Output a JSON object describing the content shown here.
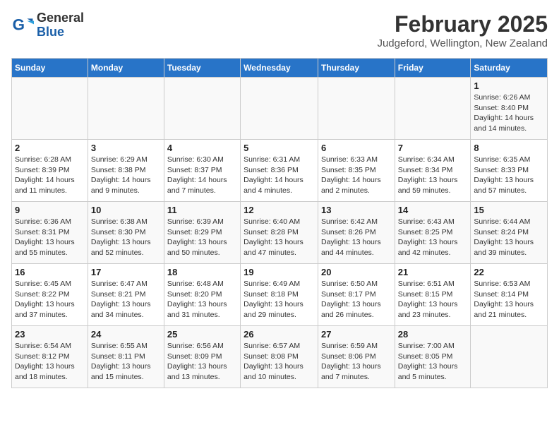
{
  "header": {
    "logo": {
      "general": "General",
      "blue": "Blue"
    },
    "title": "February 2025",
    "subtitle": "Judgeford, Wellington, New Zealand"
  },
  "days_of_week": [
    "Sunday",
    "Monday",
    "Tuesday",
    "Wednesday",
    "Thursday",
    "Friday",
    "Saturday"
  ],
  "weeks": [
    [
      {
        "day": "",
        "info": ""
      },
      {
        "day": "",
        "info": ""
      },
      {
        "day": "",
        "info": ""
      },
      {
        "day": "",
        "info": ""
      },
      {
        "day": "",
        "info": ""
      },
      {
        "day": "",
        "info": ""
      },
      {
        "day": "1",
        "info": "Sunrise: 6:26 AM\nSunset: 8:40 PM\nDaylight: 14 hours\nand 14 minutes."
      }
    ],
    [
      {
        "day": "2",
        "info": "Sunrise: 6:28 AM\nSunset: 8:39 PM\nDaylight: 14 hours\nand 11 minutes."
      },
      {
        "day": "3",
        "info": "Sunrise: 6:29 AM\nSunset: 8:38 PM\nDaylight: 14 hours\nand 9 minutes."
      },
      {
        "day": "4",
        "info": "Sunrise: 6:30 AM\nSunset: 8:37 PM\nDaylight: 14 hours\nand 7 minutes."
      },
      {
        "day": "5",
        "info": "Sunrise: 6:31 AM\nSunset: 8:36 PM\nDaylight: 14 hours\nand 4 minutes."
      },
      {
        "day": "6",
        "info": "Sunrise: 6:33 AM\nSunset: 8:35 PM\nDaylight: 14 hours\nand 2 minutes."
      },
      {
        "day": "7",
        "info": "Sunrise: 6:34 AM\nSunset: 8:34 PM\nDaylight: 13 hours\nand 59 minutes."
      },
      {
        "day": "8",
        "info": "Sunrise: 6:35 AM\nSunset: 8:33 PM\nDaylight: 13 hours\nand 57 minutes."
      }
    ],
    [
      {
        "day": "9",
        "info": "Sunrise: 6:36 AM\nSunset: 8:31 PM\nDaylight: 13 hours\nand 55 minutes."
      },
      {
        "day": "10",
        "info": "Sunrise: 6:38 AM\nSunset: 8:30 PM\nDaylight: 13 hours\nand 52 minutes."
      },
      {
        "day": "11",
        "info": "Sunrise: 6:39 AM\nSunset: 8:29 PM\nDaylight: 13 hours\nand 50 minutes."
      },
      {
        "day": "12",
        "info": "Sunrise: 6:40 AM\nSunset: 8:28 PM\nDaylight: 13 hours\nand 47 minutes."
      },
      {
        "day": "13",
        "info": "Sunrise: 6:42 AM\nSunset: 8:26 PM\nDaylight: 13 hours\nand 44 minutes."
      },
      {
        "day": "14",
        "info": "Sunrise: 6:43 AM\nSunset: 8:25 PM\nDaylight: 13 hours\nand 42 minutes."
      },
      {
        "day": "15",
        "info": "Sunrise: 6:44 AM\nSunset: 8:24 PM\nDaylight: 13 hours\nand 39 minutes."
      }
    ],
    [
      {
        "day": "16",
        "info": "Sunrise: 6:45 AM\nSunset: 8:22 PM\nDaylight: 13 hours\nand 37 minutes."
      },
      {
        "day": "17",
        "info": "Sunrise: 6:47 AM\nSunset: 8:21 PM\nDaylight: 13 hours\nand 34 minutes."
      },
      {
        "day": "18",
        "info": "Sunrise: 6:48 AM\nSunset: 8:20 PM\nDaylight: 13 hours\nand 31 minutes."
      },
      {
        "day": "19",
        "info": "Sunrise: 6:49 AM\nSunset: 8:18 PM\nDaylight: 13 hours\nand 29 minutes."
      },
      {
        "day": "20",
        "info": "Sunrise: 6:50 AM\nSunset: 8:17 PM\nDaylight: 13 hours\nand 26 minutes."
      },
      {
        "day": "21",
        "info": "Sunrise: 6:51 AM\nSunset: 8:15 PM\nDaylight: 13 hours\nand 23 minutes."
      },
      {
        "day": "22",
        "info": "Sunrise: 6:53 AM\nSunset: 8:14 PM\nDaylight: 13 hours\nand 21 minutes."
      }
    ],
    [
      {
        "day": "23",
        "info": "Sunrise: 6:54 AM\nSunset: 8:12 PM\nDaylight: 13 hours\nand 18 minutes."
      },
      {
        "day": "24",
        "info": "Sunrise: 6:55 AM\nSunset: 8:11 PM\nDaylight: 13 hours\nand 15 minutes."
      },
      {
        "day": "25",
        "info": "Sunrise: 6:56 AM\nSunset: 8:09 PM\nDaylight: 13 hours\nand 13 minutes."
      },
      {
        "day": "26",
        "info": "Sunrise: 6:57 AM\nSunset: 8:08 PM\nDaylight: 13 hours\nand 10 minutes."
      },
      {
        "day": "27",
        "info": "Sunrise: 6:59 AM\nSunset: 8:06 PM\nDaylight: 13 hours\nand 7 minutes."
      },
      {
        "day": "28",
        "info": "Sunrise: 7:00 AM\nSunset: 8:05 PM\nDaylight: 13 hours\nand 5 minutes."
      },
      {
        "day": "",
        "info": ""
      }
    ]
  ]
}
